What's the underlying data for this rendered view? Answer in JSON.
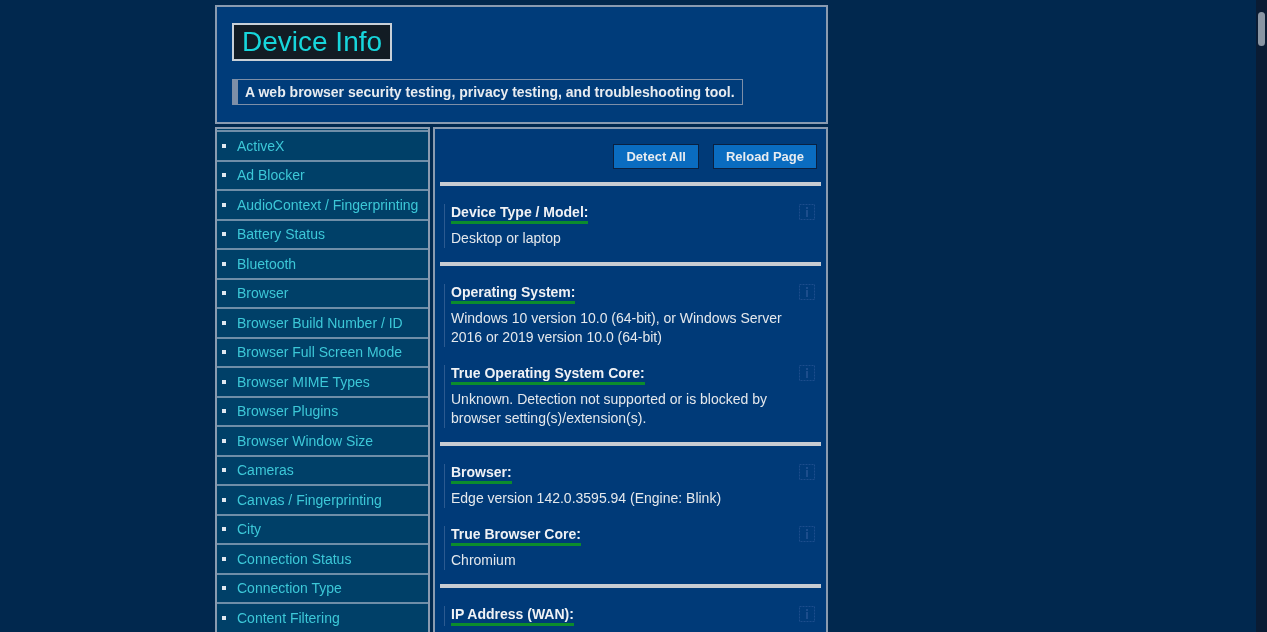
{
  "header": {
    "title": "Device Info",
    "tagline": "A web browser security testing, privacy testing, and troubleshooting tool."
  },
  "sidebar": {
    "items": [
      "ActiveX",
      "Ad Blocker",
      "AudioContext / Fingerprinting",
      "Battery Status",
      "Bluetooth",
      "Browser",
      "Browser Build Number / ID",
      "Browser Full Screen Mode",
      "Browser MIME Types",
      "Browser Plugins",
      "Browser Window Size",
      "Cameras",
      "Canvas / Fingerprinting",
      "City",
      "Connection Status",
      "Connection Type",
      "Content Filtering"
    ]
  },
  "buttons": [
    "Detect All",
    "Reload Page"
  ],
  "groups": [
    {
      "fields": [
        {
          "label": "Device Type / Model:",
          "value": "Desktop or laptop"
        }
      ]
    },
    {
      "fields": [
        {
          "label": "Operating System:",
          "value": "Windows 10 version 10.0 (64-bit), or Windows Server 2016 or 2019 version 10.0 (64-bit)"
        },
        {
          "label": "True Operating System Core:",
          "value": "Unknown. Detection not supported or is blocked by browser setting(s)/extension(s)."
        }
      ]
    },
    {
      "fields": [
        {
          "label": "Browser:",
          "value": "Edge version 142.0.3595.94 (Engine: Blink)"
        },
        {
          "label": "True Browser Core:",
          "value": "Chromium"
        }
      ]
    },
    {
      "fields": [
        {
          "label": "IP Address (WAN):"
        }
      ]
    }
  ]
}
